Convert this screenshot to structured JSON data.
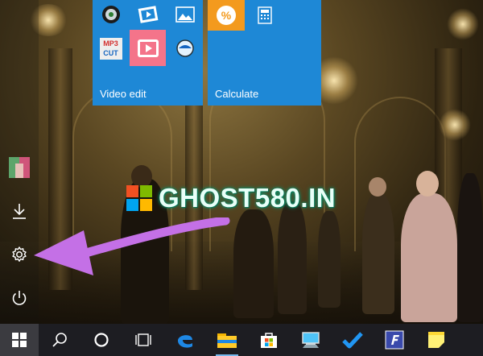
{
  "tiles": {
    "group1_label": "Video edit",
    "group2_label": "Calculate",
    "mp3cut_text": [
      "MP3",
      "CUT"
    ]
  },
  "watermark": {
    "text": "GHOST580.IN"
  },
  "left_rail": {
    "items": [
      "user-avatar",
      "downloads-icon",
      "settings-icon",
      "power-icon"
    ]
  },
  "taskbar": {
    "items": [
      "start-button",
      "search-icon",
      "cortana-icon",
      "task-view-icon",
      "edge-icon",
      "file-explorer-icon",
      "store-icon",
      "this-pc-icon",
      "todo-check-icon",
      "forms-app-icon",
      "sticky-notes-icon"
    ]
  },
  "colors": {
    "tile_blue": "#1e88d6",
    "calc_orange": "#f39a1e",
    "video_pink": "#f4748a",
    "arrow_purple": "#c470e6",
    "taskbar": "#1d1d22"
  }
}
